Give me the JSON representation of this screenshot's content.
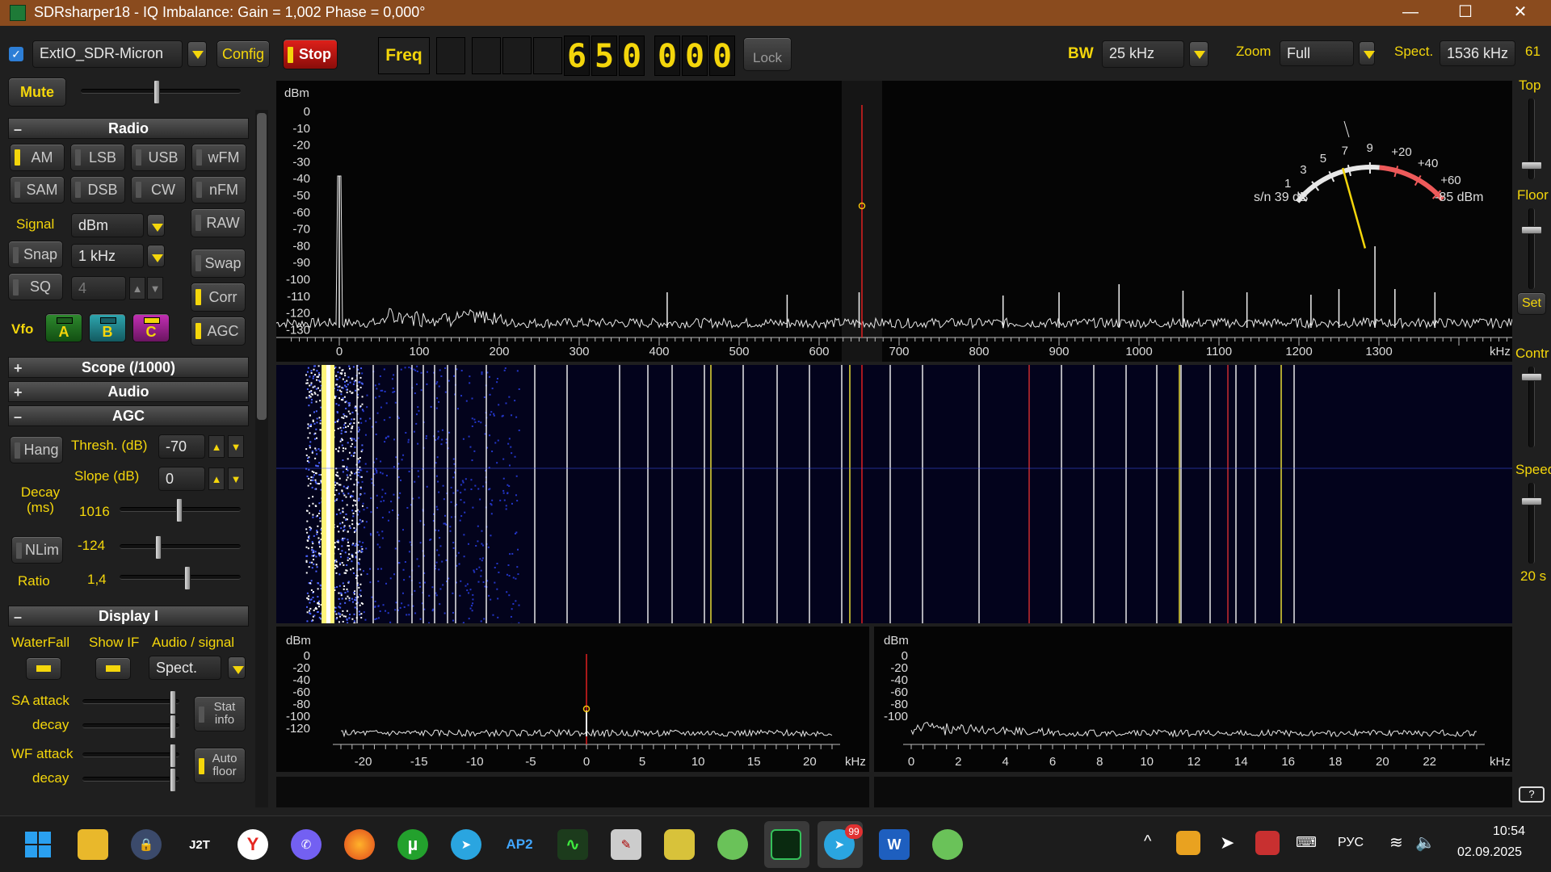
{
  "window": {
    "title": "SDRsharper18 - IQ Imbalance: Gain = 1,002 Phase = 0,000°",
    "minimize": "—",
    "maximize": "☐",
    "close": "✕"
  },
  "toolbar": {
    "device": "ExtIO_SDR-Micron",
    "config": "Config",
    "stop": "Stop",
    "freq_label": "Freq",
    "freq_digits": [
      "6",
      "5",
      "0",
      "0",
      "0",
      "0"
    ],
    "lock": "Lock",
    "bw_label": "BW",
    "bw_value": "25 kHz",
    "zoom_label": "Zoom",
    "zoom_value": "Full",
    "spect_label": "Spect.",
    "spect_value": "1536 kHz",
    "right_num": "61"
  },
  "left": {
    "mute": "Mute",
    "section_radio": "Radio",
    "modes": [
      {
        "label": "AM",
        "on": true
      },
      {
        "label": "LSB",
        "on": false
      },
      {
        "label": "USB",
        "on": false
      },
      {
        "label": "wFM",
        "on": false
      },
      {
        "label": "SAM",
        "on": false
      },
      {
        "label": "DSB",
        "on": false
      },
      {
        "label": "CW",
        "on": false
      },
      {
        "label": "nFM",
        "on": false
      }
    ],
    "signal_label": "Signal",
    "signal_value": "dBm",
    "raw": "RAW",
    "snap": "Snap",
    "snap_value": "1 kHz",
    "swap": "Swap",
    "sq": "SQ",
    "sq_value": "4",
    "corr": "Corr",
    "vfo_label": "Vfo",
    "vfo_a": "A",
    "vfo_b": "B",
    "vfo_c": "C",
    "agc": "AGC",
    "section_scope": "Scope (/1000)",
    "section_audio": "Audio",
    "section_agc": "AGC",
    "hang": "Hang",
    "thresh_label": "Thresh. (dB)",
    "thresh_value": "-70",
    "slope_label": "Slope (dB)",
    "slope_value": "0",
    "decay_label": "Decay\n(ms)",
    "decay_value": "1016",
    "nlim": "NLim",
    "nlim_value": "-124",
    "ratio_label": "Ratio",
    "ratio_value": "1,4",
    "section_display": "Display I",
    "waterfall_label": "WaterFall",
    "showif_label": "Show IF",
    "audio_signal_label": "Audio / signal",
    "spect_select": "Spect.",
    "sa_attack": "SA attack",
    "sa_decay": "decay",
    "stat_info": "Stat\ninfo",
    "wf_attack": "WF attack",
    "wf_decay": "decay",
    "auto_floor": "Auto\nfloor",
    "plus": "+",
    "minus": "–"
  },
  "right": {
    "top": "Top",
    "floor": "Floor",
    "set": "Set",
    "contr": "Contr",
    "speed": "Speed",
    "speed_value": "20 s",
    "help": "?"
  },
  "spectrum": {
    "ylabel": "dBm",
    "yticks": [
      "0",
      "-10",
      "-20",
      "-30",
      "-40",
      "-50",
      "-60",
      "-70",
      "-80",
      "-90",
      "-100",
      "-110",
      "-120",
      "-130"
    ],
    "xticks": [
      "0",
      "100",
      "200",
      "300",
      "400",
      "500",
      "600",
      "700",
      "800",
      "900",
      "1000",
      "1100",
      "1200",
      "1300"
    ],
    "xunit": "kHz",
    "smeter": {
      "scale": [
        "1",
        "3",
        "5",
        "7",
        "9",
        "+20",
        "+40",
        "+60"
      ],
      "sn": "s/n 39 dB",
      "level": "-85 dBm"
    }
  },
  "if_panel": {
    "ylabel": "dBm",
    "yticks": [
      "0",
      "-20",
      "-40",
      "-60",
      "-80",
      "-100",
      "-120"
    ],
    "xticks": [
      "-20",
      "-15",
      "-10",
      "-5",
      "0",
      "5",
      "10",
      "15",
      "20"
    ],
    "xunit": "kHz"
  },
  "audio_panel": {
    "ylabel": "dBm",
    "yticks": [
      "0",
      "-20",
      "-40",
      "-60",
      "-80",
      "-100"
    ],
    "xticks": [
      "0",
      "2",
      "4",
      "6",
      "8",
      "10",
      "12",
      "14",
      "16",
      "18",
      "20",
      "22"
    ],
    "xunit": "kHz"
  },
  "taskbar": {
    "j2t": "J2T",
    "ap2": "AP2",
    "badge": "99",
    "lang": "РУС",
    "time": "10:54",
    "date": "02.09.2025",
    "word": "W"
  }
}
